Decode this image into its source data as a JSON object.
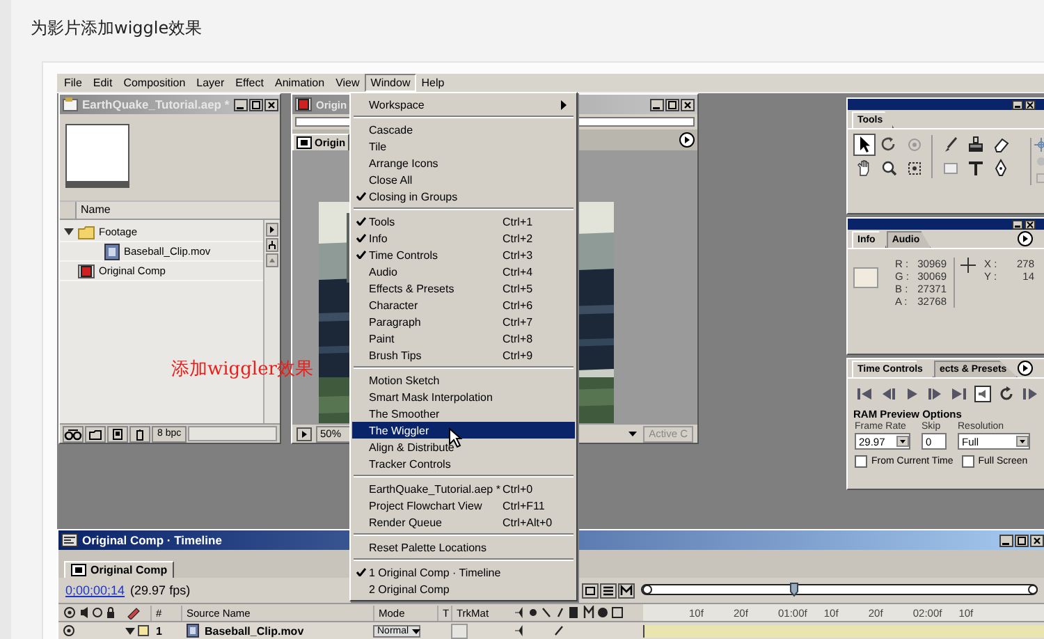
{
  "page_title": "为影片添加wiggle效果",
  "menubar": [
    {
      "label": "File",
      "selected": false
    },
    {
      "label": "Edit",
      "selected": false
    },
    {
      "label": "Composition",
      "selected": false
    },
    {
      "label": "Layer",
      "selected": false
    },
    {
      "label": "Effect",
      "selected": false
    },
    {
      "label": "Animation",
      "selected": false
    },
    {
      "label": "View",
      "selected": false
    },
    {
      "label": "Window",
      "selected": true
    },
    {
      "label": "Help",
      "selected": false
    }
  ],
  "project_window": {
    "title": "EarthQuake_Tutorial.aep *",
    "column": "Name",
    "bit_depth": "8 bpc",
    "items": [
      {
        "label": "Footage",
        "kind": "folder",
        "expanded": true,
        "children": [
          {
            "label": "Baseball_Clip.mov",
            "kind": "footage"
          }
        ]
      },
      {
        "label": "Original Comp",
        "kind": "comp"
      }
    ]
  },
  "comp_window": {
    "title": "Origin",
    "tab": "Origin",
    "zoom": "50%",
    "view": "Active C"
  },
  "menu": {
    "sections": [
      [
        {
          "label": "Workspace",
          "kind": "submenu",
          "checked": false,
          "selected": false
        }
      ],
      [
        {
          "label": "Cascade",
          "kind": "command",
          "checked": false,
          "selected": false
        },
        {
          "label": "Tile",
          "kind": "command",
          "checked": false,
          "selected": false
        },
        {
          "label": "Arrange Icons",
          "kind": "command",
          "checked": false,
          "selected": false
        },
        {
          "label": "Close All",
          "kind": "command",
          "checked": false,
          "selected": false
        },
        {
          "label": "Closing in Groups",
          "kind": "command",
          "checked": true,
          "selected": false
        }
      ],
      [
        {
          "label": "Tools",
          "shortcut": "Ctrl+1",
          "kind": "command",
          "checked": true,
          "selected": false
        },
        {
          "label": "Info",
          "shortcut": "Ctrl+2",
          "kind": "command",
          "checked": true,
          "selected": false
        },
        {
          "label": "Time Controls",
          "shortcut": "Ctrl+3",
          "kind": "command",
          "checked": true,
          "selected": false
        },
        {
          "label": "Audio",
          "shortcut": "Ctrl+4",
          "kind": "command",
          "checked": false,
          "selected": false
        },
        {
          "label": "Effects & Presets",
          "shortcut": "Ctrl+5",
          "kind": "command",
          "checked": false,
          "selected": false
        },
        {
          "label": "Character",
          "shortcut": "Ctrl+6",
          "kind": "command",
          "checked": false,
          "selected": false
        },
        {
          "label": "Paragraph",
          "shortcut": "Ctrl+7",
          "kind": "command",
          "checked": false,
          "selected": false
        },
        {
          "label": "Paint",
          "shortcut": "Ctrl+8",
          "kind": "command",
          "checked": false,
          "selected": false
        },
        {
          "label": "Brush Tips",
          "shortcut": "Ctrl+9",
          "kind": "command",
          "checked": false,
          "selected": false
        }
      ],
      [
        {
          "label": "Motion Sketch",
          "kind": "command",
          "checked": false,
          "selected": false
        },
        {
          "label": "Smart Mask Interpolation",
          "kind": "command",
          "checked": false,
          "selected": false
        },
        {
          "label": "The Smoother",
          "kind": "command",
          "checked": false,
          "selected": false
        },
        {
          "label": "The Wiggler",
          "kind": "command",
          "checked": false,
          "selected": true
        },
        {
          "label": "Align & Distribute",
          "kind": "command",
          "checked": false,
          "selected": false
        },
        {
          "label": "Tracker Controls",
          "kind": "command",
          "checked": false,
          "selected": false
        }
      ],
      [
        {
          "label": "EarthQuake_Tutorial.aep *",
          "shortcut": "Ctrl+0",
          "kind": "command",
          "checked": false,
          "selected": false
        },
        {
          "label": "Project Flowchart View",
          "shortcut": "Ctrl+F11",
          "kind": "command",
          "checked": false,
          "selected": false
        },
        {
          "label": "Render Queue",
          "shortcut": "Ctrl+Alt+0",
          "kind": "command",
          "checked": false,
          "selected": false
        }
      ],
      [
        {
          "label": "Reset Palette Locations",
          "kind": "command",
          "checked": false,
          "selected": false
        }
      ],
      [
        {
          "label": "1 Original Comp · Timeline",
          "kind": "command",
          "checked": true,
          "selected": false
        },
        {
          "label": "2 Original Comp",
          "kind": "command",
          "checked": false,
          "selected": false
        }
      ]
    ]
  },
  "tools_palette": {
    "tab": "Tools"
  },
  "info_palette": {
    "tabs": [
      {
        "label": "Info",
        "selected": true
      },
      {
        "label": "Audio",
        "selected": false
      }
    ],
    "swatch": {
      "color": "#f0ebde"
    },
    "channels": [
      {
        "label": "R :",
        "value": "30969"
      },
      {
        "label": "G :",
        "value": "30069"
      },
      {
        "label": "B :",
        "value": "27371"
      },
      {
        "label": "A :",
        "value": "32768"
      }
    ],
    "position": [
      {
        "label": "X :",
        "value": "278"
      },
      {
        "label": "Y :",
        "value": "14"
      }
    ]
  },
  "time_controls": {
    "tabs": [
      {
        "label": "Time Controls",
        "selected": true
      },
      {
        "label": "ects & Presets",
        "selected": false
      }
    ],
    "ram_title": "RAM Preview Options",
    "fields": [
      {
        "label": "Frame Rate",
        "value": "29.97",
        "kind": "dropdown"
      },
      {
        "label": "Skip",
        "value": "0",
        "kind": "text"
      },
      {
        "label": "Resolution",
        "value": "Full",
        "kind": "dropdown"
      }
    ],
    "options": [
      {
        "label": "From Current Time",
        "checked": false
      },
      {
        "label": "Full Screen",
        "checked": false
      }
    ]
  },
  "timeline": {
    "title": "Original Comp · Timeline",
    "tab": "Original Comp",
    "time": "0;00;00;14",
    "fps": "(29.97 fps)",
    "columns": [
      "#",
      "Source Name",
      "Mode",
      "T",
      "TrkMat"
    ],
    "layers": [
      {
        "number": "1",
        "name": "Baseball_Clip.mov",
        "mode": "Normal"
      }
    ],
    "ruler": [
      "10f",
      "20f",
      "01:00f",
      "10f",
      "20f",
      "02:00f",
      "10f"
    ]
  },
  "annotation": "添加wiggler效果"
}
